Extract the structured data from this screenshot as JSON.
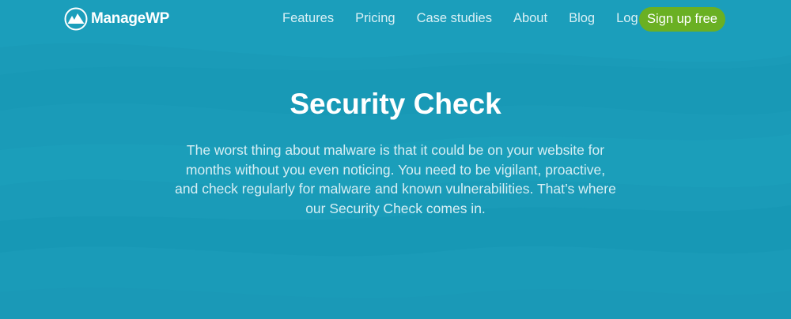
{
  "brand": {
    "logo_text": "ManageWP",
    "background_color": "#1a9bb8",
    "accent_color": "#6ab023",
    "logo_icon": "managewp-mountain-logo-icon"
  },
  "nav": {
    "links": [
      {
        "label": "Features"
      },
      {
        "label": "Pricing"
      },
      {
        "label": "Case studies"
      },
      {
        "label": "About"
      },
      {
        "label": "Blog"
      },
      {
        "label": "Log in"
      }
    ],
    "signup_label": "Sign up free"
  },
  "hero": {
    "title": "Security Check",
    "description": "The worst thing about malware is that it could be on your website for months without you even noticing. You need to be vigilant, proactive, and check regularly for malware and known vulnerabilities. That’s where our Security Check comes in."
  }
}
